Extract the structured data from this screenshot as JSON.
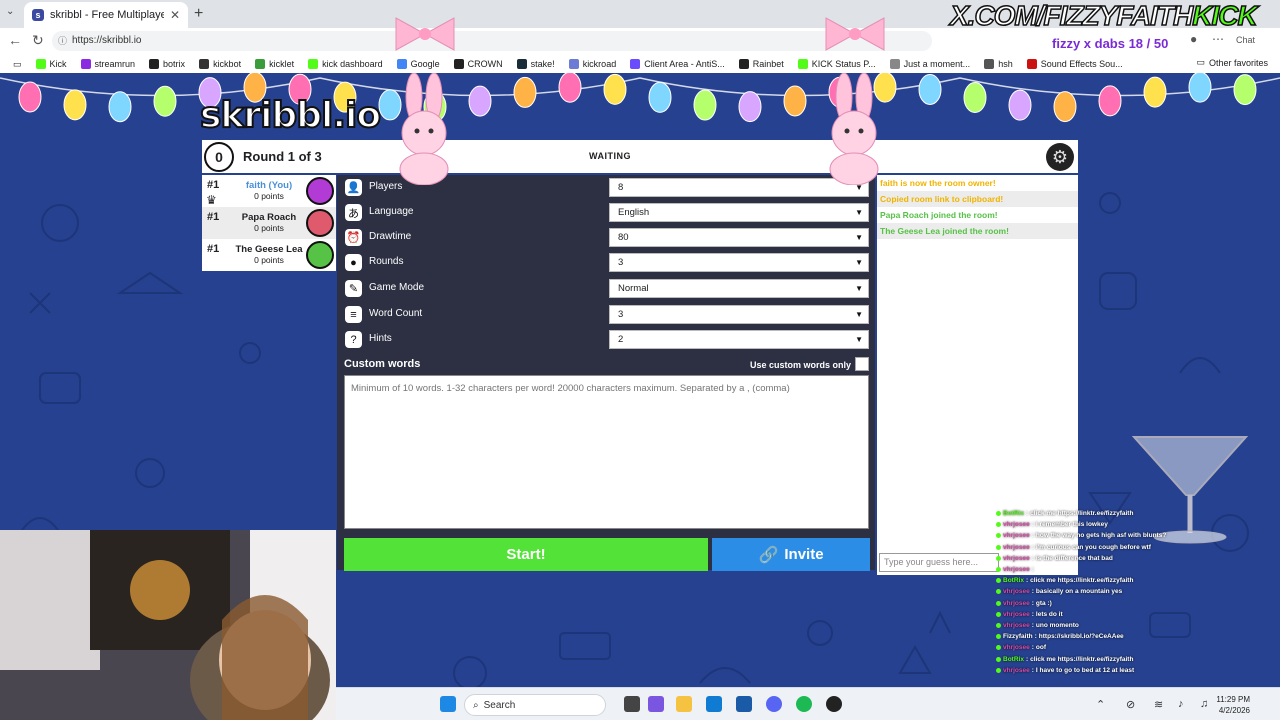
{
  "browser": {
    "tab_title": "skribbl - Free Multiplayer Drawing",
    "url": "https://skribbl.io",
    "bookmarks": [
      {
        "label": "Kick",
        "color": "#53fc18"
      },
      {
        "label": "streamrun",
        "color": "#8a2be2"
      },
      {
        "label": "botrix",
        "color": "#222222"
      },
      {
        "label": "kickbot",
        "color": "#333333"
      },
      {
        "label": "kicklet",
        "color": "#3a9d3a"
      },
      {
        "label": "kick dashboard",
        "color": "#53fc18"
      },
      {
        "label": "Google",
        "color": "#4285f4"
      },
      {
        "label": "CROWN",
        "color": "#222222"
      },
      {
        "label": "stake!",
        "color": "#1a2c38"
      },
      {
        "label": "kickroad",
        "color": "#6b7bd6"
      },
      {
        "label": "Client Area - AntiS...",
        "color": "#6a4cff"
      },
      {
        "label": "Rainbet",
        "color": "#222222"
      },
      {
        "label": "KICK Status P...",
        "color": "#53fc18"
      },
      {
        "label": "Just a moment...",
        "color": "#888888"
      },
      {
        "label": "hsh",
        "color": "#555555"
      },
      {
        "label": "Sound Effects Sou...",
        "color": "#cc1111"
      }
    ],
    "other_favorites": "Other favorites",
    "chat_btn": "Chat"
  },
  "overlay": {
    "url_text": "X.COM/FIZZYFAITH",
    "kick_text": "KICK",
    "goal_text": "fizzy x dabs 18 / 50"
  },
  "game": {
    "logo": "skribbl.io",
    "round_number": "0",
    "round_label": "Round 1 of 3",
    "status": "WAITING",
    "players": [
      {
        "rank": "#1",
        "name": "faith (You)",
        "points": "0 points",
        "you": true,
        "color": "#b23bd6"
      },
      {
        "rank": "#1",
        "name": "Papa Roach",
        "points": "0 points",
        "you": false,
        "color": "#e05a6e"
      },
      {
        "rank": "#1",
        "name": "The Geese Lea",
        "points": "0 points",
        "you": false,
        "color": "#56c246"
      }
    ],
    "settings": [
      {
        "icon": "player-icon",
        "glyph": "👤",
        "label": "Players",
        "value": "8"
      },
      {
        "icon": "language-icon",
        "glyph": "あ",
        "label": "Language",
        "value": "English"
      },
      {
        "icon": "drawtime-icon",
        "glyph": "⏰",
        "label": "Drawtime",
        "value": "80"
      },
      {
        "icon": "rounds-icon",
        "glyph": "●",
        "label": "Rounds",
        "value": "3"
      },
      {
        "icon": "gamemode-icon",
        "glyph": "✎",
        "label": "Game Mode",
        "value": "Normal"
      },
      {
        "icon": "wordcount-icon",
        "glyph": "≡",
        "label": "Word Count",
        "value": "3"
      },
      {
        "icon": "hints-icon",
        "glyph": "?",
        "label": "Hints",
        "value": "2"
      }
    ],
    "custom_words_label": "Custom words",
    "use_custom_only": "Use custom words only",
    "custom_words_placeholder": "Minimum of 10 words. 1-32 characters per word! 20000 characters maximum. Separated by a , (comma)",
    "start_label": "Start!",
    "invite_label": "Invite"
  },
  "chat": {
    "messages": [
      {
        "text": "faith is now the room owner!",
        "color": "#f0b400"
      },
      {
        "text": "Copied room link to clipboard!",
        "color": "#f0b400"
      },
      {
        "text": "Papa Roach joined the room!",
        "color": "#56c246"
      },
      {
        "text": "The Geese Lea joined the room!",
        "color": "#56c246"
      }
    ],
    "placeholder": "Type your guess here..."
  },
  "stream_chat": [
    {
      "user": "BotRix",
      "msg": "click me https://linktr.ee/fizzyfaith",
      "color": "#53fc18"
    },
    {
      "user": "vhrjosee",
      "msg": "i remember this lowkey",
      "color": "#d94aa8"
    },
    {
      "user": "vhrjosee",
      "msg": "how the way no gets high asf with blunts?",
      "color": "#d94aa8"
    },
    {
      "user": "vhrjosee",
      "msg": "i'm curious can you cough before wtf",
      "color": "#d94aa8"
    },
    {
      "user": "vhrjosee",
      "msg": "is the difference that bad",
      "color": "#d94aa8"
    },
    {
      "user": "vhrjosee",
      "msg": "",
      "color": "#d94aa8"
    },
    {
      "user": "BotRix",
      "msg": "click me https://linktr.ee/fizzyfaith",
      "color": "#53fc18"
    },
    {
      "user": "vhrjosee",
      "msg": "basically on a mountain yes",
      "color": "#d94aa8"
    },
    {
      "user": "vhrjosee",
      "msg": "gta :)",
      "color": "#d94aa8"
    },
    {
      "user": "vhrjosee",
      "msg": "lets do it",
      "color": "#d94aa8"
    },
    {
      "user": "vhrjosee",
      "msg": "uno momento",
      "color": "#d94aa8"
    },
    {
      "user": "Fizzyfaith",
      "msg": "https://skribbl.io/?eCeAAee",
      "color": "#ffffff"
    },
    {
      "user": "vhrjosee",
      "msg": "oof",
      "color": "#d94aa8"
    },
    {
      "user": "BotRix",
      "msg": "click me https://linktr.ee/fizzyfaith",
      "color": "#53fc18"
    },
    {
      "user": "vhrjosee",
      "msg": "I have to go to bed at 12 at least",
      "color": "#d94aa8"
    }
  ],
  "taskbar": {
    "search_label": "Search",
    "time": "11:29 PM",
    "date": "4/2/2026"
  }
}
